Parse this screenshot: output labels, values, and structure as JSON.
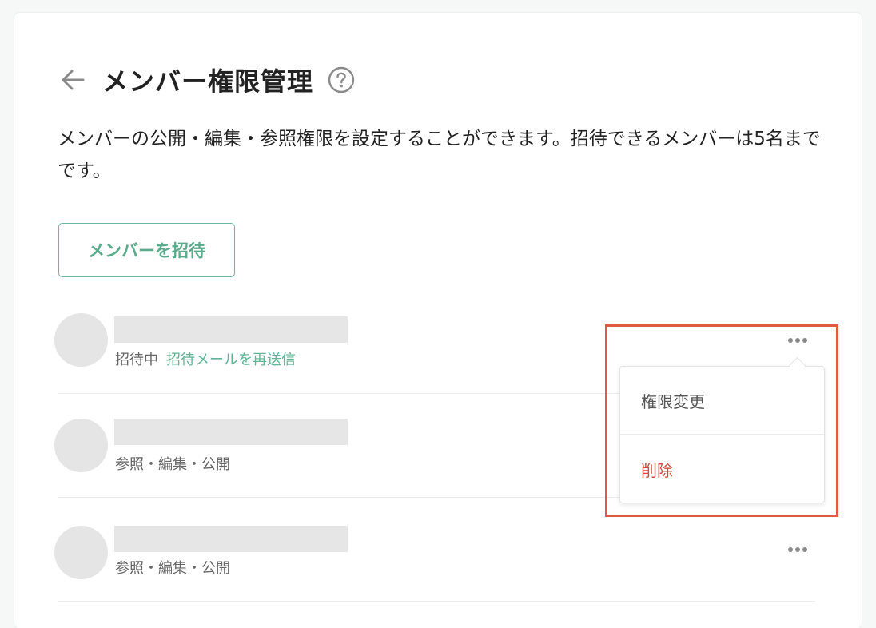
{
  "header": {
    "title": "メンバー権限管理",
    "back_icon": "arrow-left-icon",
    "help_icon": "question-circle-icon"
  },
  "description": "メンバーの公開・編集・参照権限を設定することができます。招待できるメンバーは5名までです。",
  "invite_button": {
    "label": "メンバーを招待"
  },
  "members": [
    {
      "status": "招待中",
      "resend_link": "招待メールを再送信"
    },
    {
      "permissions": "参照・編集・公開"
    },
    {
      "permissions": "参照・編集・公開"
    }
  ],
  "dropdown": {
    "items": [
      {
        "label": "権限変更"
      },
      {
        "label": "削除"
      }
    ]
  },
  "colors": {
    "accent_green": "#59ab8c",
    "delete_red": "#d04a3c",
    "highlight": "#dd5c3f"
  }
}
